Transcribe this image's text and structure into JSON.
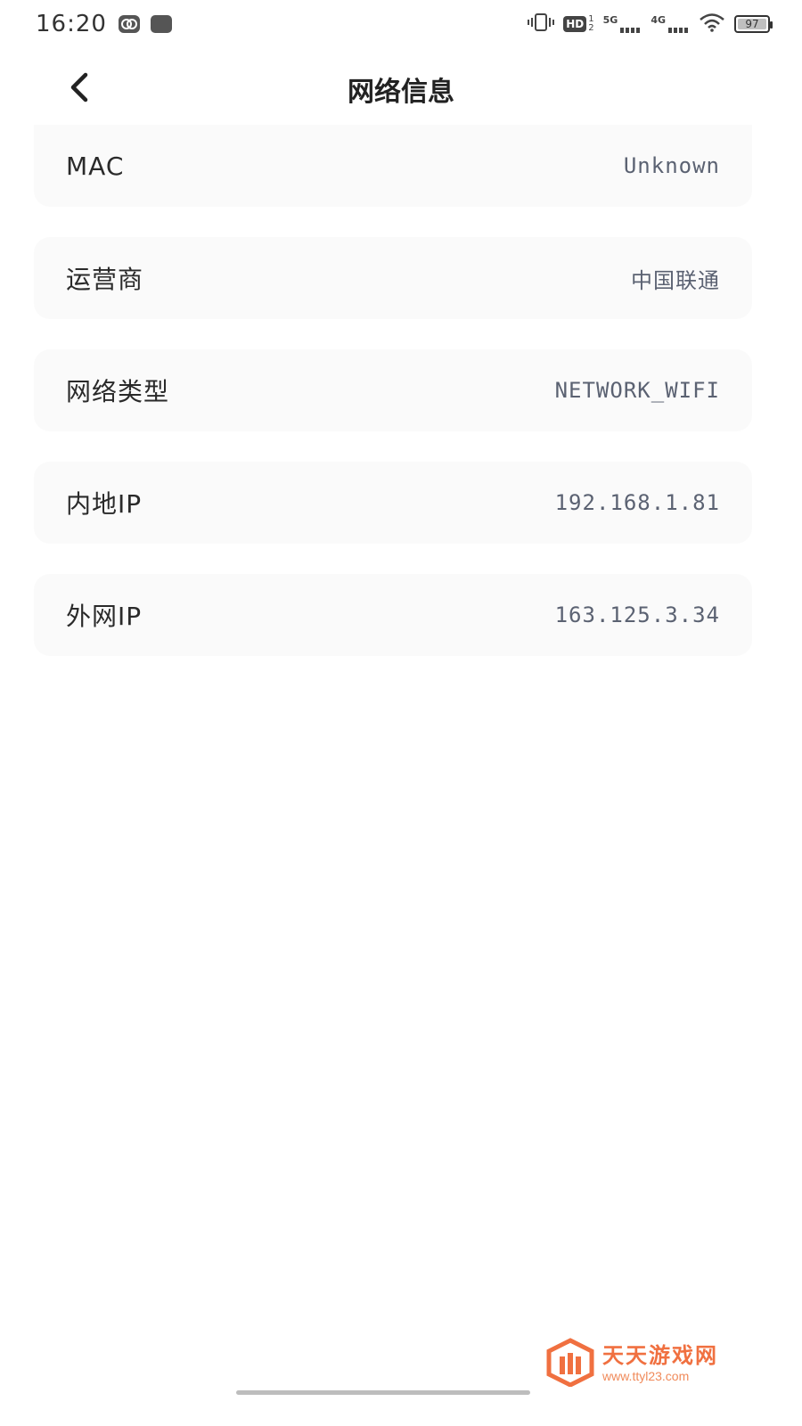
{
  "status_bar": {
    "time": "16:20",
    "battery_level": "97",
    "network_5g": "5G",
    "network_4g": "4G",
    "hd_label": "HD",
    "hd_sub_top": "1",
    "hd_sub_bottom": "2"
  },
  "header": {
    "title": "网络信息"
  },
  "info_items": [
    {
      "label": "MAC",
      "value": "Unknown"
    },
    {
      "label": "运营商",
      "value": "中国联通"
    },
    {
      "label": "网络类型",
      "value": "NETWORK_WIFI"
    },
    {
      "label": "内地IP",
      "value": "192.168.1.81"
    },
    {
      "label": "外网IP",
      "value": "163.125.3.34"
    }
  ],
  "watermark": {
    "title": "天天游戏网",
    "url": "www.ttyl23.com"
  },
  "colors": {
    "card_background": "#fafafa",
    "value_text": "#5b6272",
    "watermark": "#f07040"
  }
}
